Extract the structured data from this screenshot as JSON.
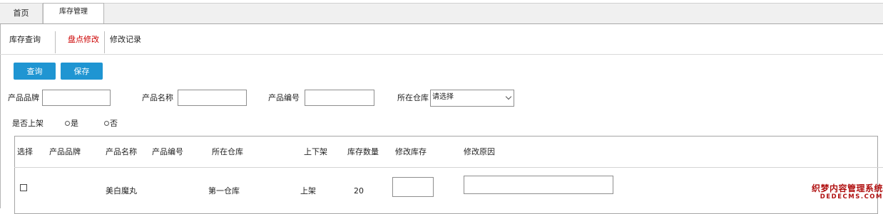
{
  "tabs": [
    {
      "label": "首页",
      "active": false
    },
    {
      "label": "库存管理",
      "active": true
    }
  ],
  "subnav": [
    {
      "label": "库存查询",
      "active": false
    },
    {
      "label": "盘点修改",
      "active": true
    },
    {
      "label": "修改记录",
      "active": false
    }
  ],
  "buttons": {
    "query": "查询",
    "save": "保存"
  },
  "filters": {
    "brand_label": "产品品牌",
    "name_label": "产品名称",
    "code_label": "产品编号",
    "warehouse_label": "所在仓库",
    "warehouse_value": "请选择",
    "shelf_label": "是否上架",
    "shelf_yes": "是",
    "shelf_no": "否"
  },
  "table": {
    "headers": [
      "选择",
      "产品品牌",
      "产品名称",
      "产品编号",
      "所在仓库",
      "上下架",
      "库存数量",
      "修改库存",
      "修改原因"
    ],
    "rows": [
      {
        "brand": "",
        "name": "美白魔丸",
        "code": "",
        "warehouse": "第一仓库",
        "shelf": "上架",
        "qty": "20"
      }
    ]
  },
  "watermark": {
    "line1": "织梦内容管理系统",
    "line2": "DEDECMS.COM"
  },
  "colors": {
    "accent": "#1f95d2",
    "active_subnav": "#cc0000"
  }
}
